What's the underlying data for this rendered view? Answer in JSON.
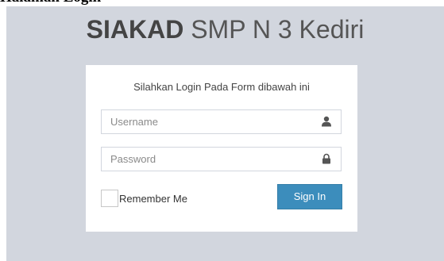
{
  "header": {
    "brand_bold": "SIAKAD",
    "brand_rest": " SMP N 3 Kediri"
  },
  "login": {
    "message": "Silahkan Login Pada Form dibawah ini",
    "username_placeholder": "Username",
    "password_placeholder": "Password",
    "remember_label": "Remember Me",
    "signin_label": "Sign In"
  },
  "icons": {
    "username": "user-icon",
    "password": "lock-icon"
  },
  "colors": {
    "background": "#d2d6de",
    "primary_button": "#3c8dbc"
  },
  "document_fragment": {
    "text": "Halaman Login"
  }
}
